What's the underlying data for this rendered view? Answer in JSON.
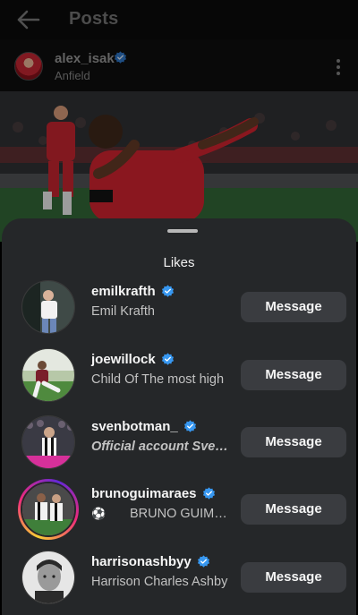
{
  "topbar": {
    "title": "Posts"
  },
  "post": {
    "username": "alex_isak",
    "location": "Anfield"
  },
  "sheet": {
    "title": "Likes"
  },
  "likes": [
    {
      "username": "emilkrafth",
      "fullname": "Emil Krafth",
      "button": "Message"
    },
    {
      "username": "joewillock",
      "fullname": "Child Of The most high",
      "button": "Message"
    },
    {
      "username": "svenbotman_",
      "fullname": "Official account Sven Botman",
      "button": "Message"
    },
    {
      "username": "brunoguimaraes",
      "fullname": "BRUNO GUIMARÃES",
      "fullname_prefix": "⚽",
      "button": "Message"
    },
    {
      "username": "harrisonashbyy",
      "fullname": "Harrison Charles Ashby",
      "button": "Message"
    }
  ],
  "colors": {
    "verified": "#3797f0",
    "sheet": "#252729",
    "button": "#3a3c40"
  }
}
